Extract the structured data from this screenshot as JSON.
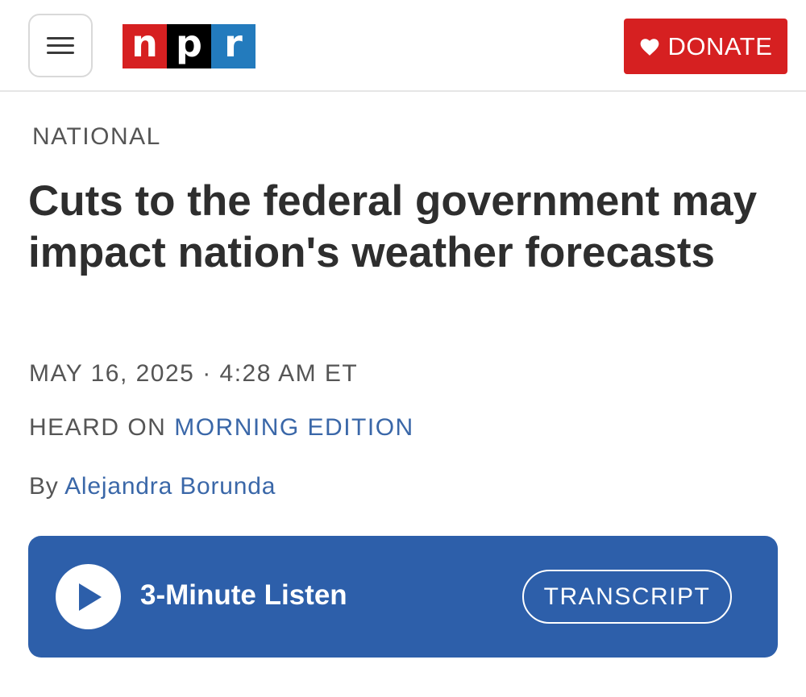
{
  "header": {
    "logo": {
      "letters": [
        "n",
        "p",
        "r"
      ]
    },
    "donate_label": "DONATE"
  },
  "article": {
    "section": "NATIONAL",
    "headline": "Cuts to the federal government may impact nation's weather forecasts",
    "dateline": "MAY 16, 2025 · 4:28 AM ET",
    "heard_on_prefix": "HEARD ON",
    "program": "MORNING EDITION",
    "byline_prefix": "By",
    "author": "Alejandra Borunda"
  },
  "player": {
    "listen_label": "3-Minute Listen",
    "transcript_label": "TRANSCRIPT"
  },
  "colors": {
    "brand_red": "#d62021",
    "npr_black": "#000000",
    "npr_blue": "#237bbd",
    "player_blue": "#2d5faa",
    "link_blue": "#3a67a8"
  },
  "icons": [
    "hamburger-menu-icon",
    "heart-icon",
    "play-icon"
  ]
}
